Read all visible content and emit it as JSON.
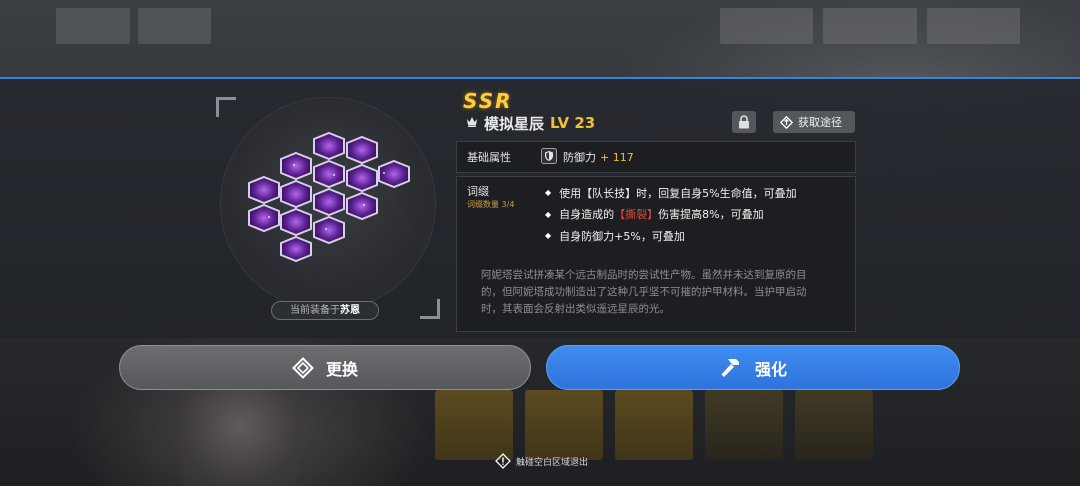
{
  "item": {
    "rarity": "SSR",
    "name": "模拟星辰",
    "level": "LV 23",
    "equipped_prefix": "当前装备于",
    "equipped_to": "苏恩"
  },
  "header": {
    "source_label": "获取途径"
  },
  "stats": {
    "label": "基础属性",
    "name": "防御力",
    "bonus": "+ 117"
  },
  "affix": {
    "title": "词缀",
    "count": "词缀数量 3/4",
    "items": [
      "使用【队长技】时，回复自身5%生命值，可叠加",
      "自身造成的",
      "【撕裂】",
      "伤害提高8%，可叠加",
      "自身防御力+5%，可叠加"
    ]
  },
  "description": "阿妮塔尝试拼凑某个远古制品时的尝试性产物。虽然并未达到复原的目的，但阿妮塔成功制造出了这种几乎坚不可摧的护甲材料。当护甲启动时，其表面会反射出类似遥远星辰的光。",
  "actions": {
    "swap_label": "更换",
    "upgrade_label": "强化"
  },
  "hint": "触碰空白区域退出",
  "colors": {
    "accent_blue": "#3f7fe0",
    "rarity_gold": "#ffcf3a",
    "level_gold": "#f0c030",
    "highlight_red": "#e04a3a",
    "crystal_purple": "#8a3cc8"
  },
  "icons": [
    "crown-icon",
    "lock-icon",
    "source-icon",
    "shield-icon",
    "swap-icon",
    "hammer-icon",
    "info-icon"
  ]
}
